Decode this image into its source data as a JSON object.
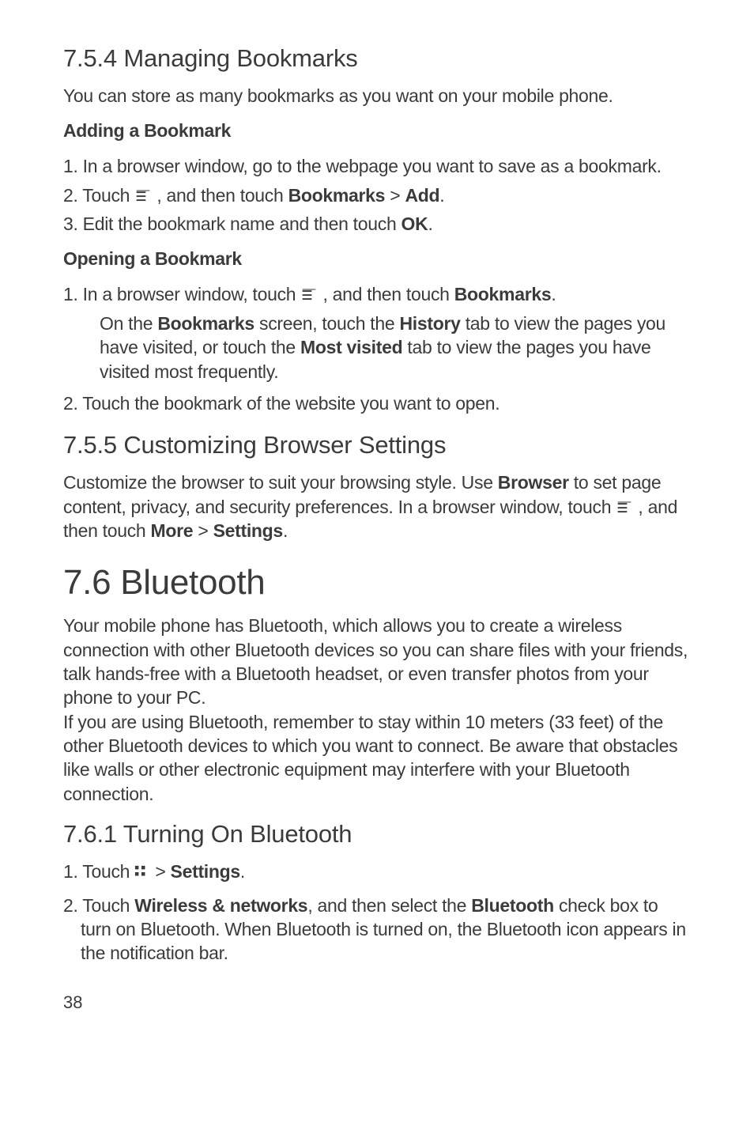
{
  "s754": {
    "heading": "7.5.4  Managing Bookmarks",
    "intro": "You can store as many bookmarks as you want on your mobile phone.",
    "adding_title": "Adding a Bookmark",
    "adding_step1": "1. In a browser window, go to the webpage you want to save as a bookmark.",
    "adding_step2_a": "2. Touch ",
    "adding_step2_b": " , and then touch ",
    "adding_step2_c": "Bookmarks",
    "adding_step2_d": " > ",
    "adding_step2_e": "Add",
    "adding_step2_f": ".",
    "adding_step3_a": "3. Edit the bookmark name and then touch ",
    "adding_step3_b": "OK",
    "adding_step3_c": ".",
    "opening_title": "Opening a Bookmark",
    "opening_step1_a": "1. In a browser window, touch ",
    "opening_step1_b": " , and then touch ",
    "opening_step1_c": "Bookmarks",
    "opening_step1_d": ".",
    "opening_note_a": "On the ",
    "opening_note_b": "Bookmarks",
    "opening_note_c": " screen, touch the ",
    "opening_note_d": "History",
    "opening_note_e": " tab to view the pages you have visited, or touch the ",
    "opening_note_f": "Most visited",
    "opening_note_g": " tab to view the pages you have visited most frequently.",
    "opening_step2": "2. Touch the bookmark of the website you want to open."
  },
  "s755": {
    "heading": "7.5.5  Customizing Browser Settings",
    "para1_a": "Customize the browser to suit your browsing style. Use ",
    "para1_b": "Browser",
    "para1_c": " to set page content, privacy, and security preferences. In a browser window, touch ",
    "para1_d": " , and then touch ",
    "para1_e": "More",
    "para1_f": " > ",
    "para1_g": "Settings",
    "para1_h": "."
  },
  "s76": {
    "heading": "7.6  Bluetooth",
    "para": "Your mobile phone has Bluetooth, which allows you to create a wireless connection with other Bluetooth devices so you can share files with your friends, talk hands-free with a Bluetooth headset, or even transfer photos from your phone to your PC.\nIf you are using Bluetooth, remember to stay within 10 meters (33 feet) of the other Bluetooth devices to which you want to connect. Be aware that obstacles like walls or other electronic equipment may interfere with your Bluetooth connection."
  },
  "s761": {
    "heading": "7.6.1  Turning On Bluetooth",
    "step1_a": "1. Touch ",
    "step1_b": "  > ",
    "step1_c": "Settings",
    "step1_d": ".",
    "step2_a": "2. Touch ",
    "step2_b": "Wireless & networks",
    "step2_c": ", and then select the ",
    "step2_d": "Bluetooth",
    "step2_e": " check box to turn on Bluetooth. When Bluetooth is turned on, the Bluetooth icon appears in the notification bar."
  },
  "page_number": "38"
}
